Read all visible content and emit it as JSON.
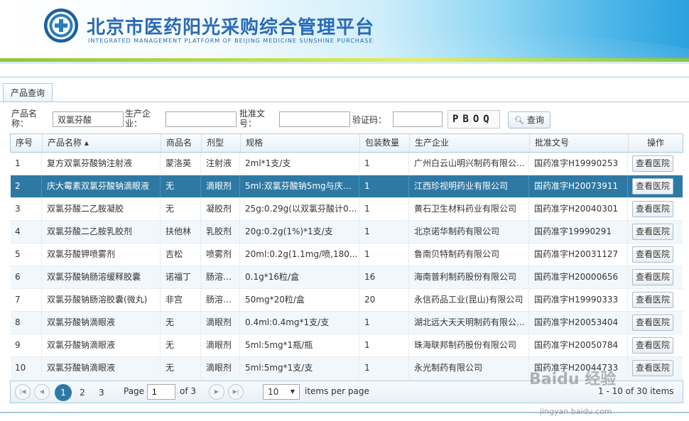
{
  "header": {
    "title_cn": "北京市医药阳光采购综合管理平台",
    "title_en": "INTEGRATED MANAGEMENT PLATFORM OF BEIJING MEDICINE SUNSHINE PURCHASE"
  },
  "tab": {
    "label": "产品查询"
  },
  "search": {
    "product_name_label": "产品名称：",
    "product_name_value": "双氯芬酸",
    "manufacturer_label": "生产企业：",
    "manufacturer_value": "",
    "approval_label": "批准文号：",
    "approval_value": "",
    "captcha_label": "验证码：",
    "captcha_value": "",
    "captcha_image_text": "PBOQ",
    "search_button": "查询"
  },
  "table": {
    "columns": [
      "序号",
      "产品名称 ▴",
      "商品名",
      "剂型",
      "规格",
      "包装数量",
      "生产企业",
      "批准文号",
      "操作"
    ],
    "action_label": "查看医院",
    "rows": [
      {
        "no": "1",
        "name": "复方双氯芬酸钠注射液",
        "trade": "蒙洛英",
        "form": "注射液",
        "spec": "2ml*1支/支",
        "qty": "1",
        "maker": "广州白云山明兴制药有限公...",
        "approval": "国药准字H19990253"
      },
      {
        "no": "2",
        "name": "庆大霉素双氯芬酸钠滴眼液",
        "trade": "无",
        "form": "滴眼剂",
        "spec": "5ml:双氯芬酸钠5mg与庆大...",
        "qty": "1",
        "maker": "江西珍视明药业有限公司",
        "approval": "国药准字H20073911"
      },
      {
        "no": "3",
        "name": "双氯芬酸二乙胺凝胶",
        "trade": "无",
        "form": "凝胶剂",
        "spec": "25g:0.29g(以双氯芬酸计0....",
        "qty": "1",
        "maker": "黄石卫生材料药业有限公司",
        "approval": "国药准字H20040301"
      },
      {
        "no": "4",
        "name": "双氯芬酸二乙胺乳胶剂",
        "trade": "扶他林",
        "form": "乳胶剂",
        "spec": "20g:0.2g(1%)*1支/支",
        "qty": "1",
        "maker": "北京诺华制药有限公司",
        "approval": "国药准字19990291"
      },
      {
        "no": "5",
        "name": "双氯芬酸钾喷雾剂",
        "trade": "吉松",
        "form": "喷雾剂",
        "spec": "20ml:0.2g(1.1mg/喷,180...",
        "qty": "1",
        "maker": "鲁南贝特制药有限公司",
        "approval": "国药准字H20031127"
      },
      {
        "no": "6",
        "name": "双氯芬酸钠肠溶缓释胶囊",
        "trade": "诺福丁",
        "form": "肠溶缓...",
        "spec": "0.1g*16粒/盒",
        "qty": "16",
        "maker": "海南普利制药股份有限公司",
        "approval": "国药准字H20000656"
      },
      {
        "no": "7",
        "name": "双氯芬酸钠肠溶胶囊(微丸)",
        "trade": "非宫",
        "form": "肠溶胶...",
        "spec": "50mg*20粒/盒",
        "qty": "20",
        "maker": "永信药品工业(昆山)有限公司",
        "approval": "国药准字H19990333"
      },
      {
        "no": "8",
        "name": "双氯芬酸钠滴眼液",
        "trade": "无",
        "form": "滴眼剂",
        "spec": "0.4ml:0.4mg*1支/支",
        "qty": "1",
        "maker": "湖北远大天天明制药有限公...",
        "approval": "国药准字H20053404"
      },
      {
        "no": "9",
        "name": "双氯芬酸钠滴眼液",
        "trade": "无",
        "form": "滴眼剂",
        "spec": "5ml:5mg*1瓶/瓶",
        "qty": "1",
        "maker": "珠海联邦制药股份有限公司",
        "approval": "国药准字H20050784"
      },
      {
        "no": "10",
        "name": "双氯芬酸钠滴眼液",
        "trade": "无",
        "form": "滴眼剂",
        "spec": "5ml:5mg*1支/支",
        "qty": "1",
        "maker": "永光制药有限公司",
        "approval": "国药准字H20044733"
      }
    ],
    "selected_row": "2"
  },
  "pager": {
    "pages": [
      "1",
      "2",
      "3"
    ],
    "current": "1",
    "page_label": "Page",
    "page_value": "1",
    "of_label": "of 3",
    "page_size": "10",
    "items_per_page": "items per page",
    "summary": "1 - 10 of 30 items"
  },
  "watermark": {
    "text": "Baidu 经验",
    "sub": "jingyan.baidu.com"
  },
  "colors": {
    "accent": "#2e79a4",
    "title": "#2a6ab8",
    "border": "#a9c9dc"
  }
}
